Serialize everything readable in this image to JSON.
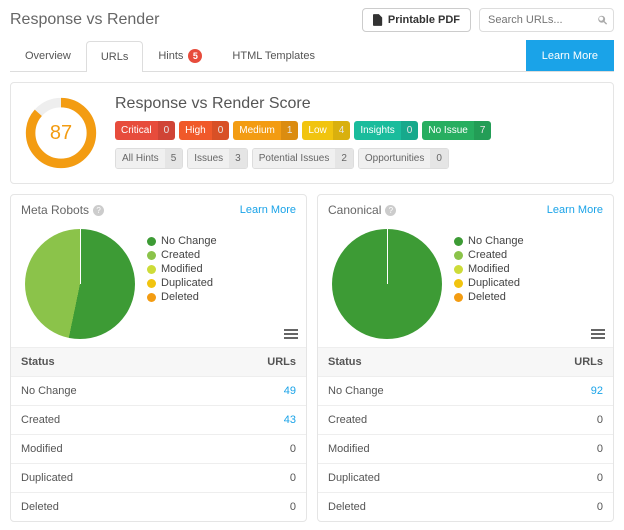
{
  "header": {
    "title": "Response vs Render",
    "pdf_label": "Printable PDF",
    "search_placeholder": "Search URLs..."
  },
  "tabs": [
    {
      "label": "Overview"
    },
    {
      "label": "URLs"
    },
    {
      "label": "Hints",
      "badge": "5"
    },
    {
      "label": "HTML Templates"
    }
  ],
  "learn_more_label": "Learn More",
  "score_panel": {
    "title": "Response vs Render Score",
    "value": "87",
    "severities": [
      {
        "cls": "critical",
        "label": "Critical",
        "count": "0"
      },
      {
        "cls": "high",
        "label": "High",
        "count": "0"
      },
      {
        "cls": "medium",
        "label": "Medium",
        "count": "1"
      },
      {
        "cls": "low",
        "label": "Low",
        "count": "4"
      },
      {
        "cls": "insights",
        "label": "Insights",
        "count": "0"
      },
      {
        "cls": "noissue",
        "label": "No Issue",
        "count": "7"
      }
    ],
    "filters": [
      {
        "label": "All Hints",
        "count": "5"
      },
      {
        "label": "Issues",
        "count": "3"
      },
      {
        "label": "Potential Issues",
        "count": "2"
      },
      {
        "label": "Opportunities",
        "count": "0"
      }
    ]
  },
  "legend_labels": [
    "No Change",
    "Created",
    "Modified",
    "Duplicated",
    "Deleted"
  ],
  "legend_colors": {
    "no_change": "#3d9b35",
    "created": "#8bc34a",
    "modified": "#cddc39",
    "duplicated": "#f1c40f",
    "deleted": "#f39c12"
  },
  "table_headers": {
    "status": "Status",
    "urls": "URLs"
  },
  "cards": {
    "meta": {
      "title": "Meta Robots",
      "rows": [
        {
          "status": "No Change",
          "urls": "49",
          "link": true
        },
        {
          "status": "Created",
          "urls": "43",
          "link": true
        },
        {
          "status": "Modified",
          "urls": "0",
          "link": false
        },
        {
          "status": "Duplicated",
          "urls": "0",
          "link": false
        },
        {
          "status": "Deleted",
          "urls": "0",
          "link": false
        }
      ]
    },
    "canonical": {
      "title": "Canonical",
      "rows": [
        {
          "status": "No Change",
          "urls": "92",
          "link": true
        },
        {
          "status": "Created",
          "urls": "0",
          "link": false
        },
        {
          "status": "Modified",
          "urls": "0",
          "link": false
        },
        {
          "status": "Duplicated",
          "urls": "0",
          "link": false
        },
        {
          "status": "Deleted",
          "urls": "0",
          "link": false
        }
      ]
    }
  },
  "chart_data": [
    {
      "type": "pie",
      "title": "Meta Robots",
      "series": [
        {
          "name": "No Change",
          "value": 49,
          "color": "#3d9b35"
        },
        {
          "name": "Created",
          "value": 43,
          "color": "#8bc34a"
        },
        {
          "name": "Modified",
          "value": 0,
          "color": "#cddc39"
        },
        {
          "name": "Duplicated",
          "value": 0,
          "color": "#f1c40f"
        },
        {
          "name": "Deleted",
          "value": 0,
          "color": "#f39c12"
        }
      ]
    },
    {
      "type": "pie",
      "title": "Canonical",
      "series": [
        {
          "name": "No Change",
          "value": 92,
          "color": "#3d9b35"
        },
        {
          "name": "Created",
          "value": 0,
          "color": "#8bc34a"
        },
        {
          "name": "Modified",
          "value": 0,
          "color": "#cddc39"
        },
        {
          "name": "Duplicated",
          "value": 0,
          "color": "#f1c40f"
        },
        {
          "name": "Deleted",
          "value": 0,
          "color": "#f39c12"
        }
      ]
    }
  ]
}
